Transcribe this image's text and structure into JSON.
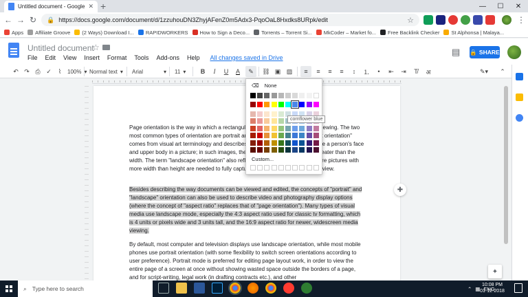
{
  "browser": {
    "tab_title": "Untitled document - Google Doc",
    "url": "https://docs.google.com/document/d/1zzuhouDN3ZhyjAFenZ0m5Adx3-PqoOaL8Hxdks8URpk/edit",
    "bookmarks": [
      {
        "label": "Apps",
        "color": "#ea4335"
      },
      {
        "label": "Affiliate Groove",
        "color": "#9e9e9e"
      },
      {
        "label": "(2 Ways) Download I...",
        "color": "#fbbc04"
      },
      {
        "label": "RAPIDWORKERS",
        "color": "#1a73e8"
      },
      {
        "label": "How to Sign a Deco...",
        "color": "#d93025"
      },
      {
        "label": "Torrents – Torrent Si...",
        "color": "#5f6368"
      },
      {
        "label": "MkCoder – Market fo...",
        "color": "#ea4335"
      },
      {
        "label": "Free Backlink Checker",
        "color": "#202124"
      },
      {
        "label": "St Alphonsa | Malaya...",
        "color": "#f9ab00"
      }
    ]
  },
  "docs": {
    "title": "Untitled document",
    "menus": [
      "File",
      "Edit",
      "View",
      "Insert",
      "Format",
      "Tools",
      "Add-ons",
      "Help"
    ],
    "save_status": "All changes saved in Drive",
    "share_label": "SHARE",
    "toolbar": {
      "zoom": "100%",
      "style": "Normal text",
      "font": "Arial",
      "size": "11"
    }
  },
  "palette": {
    "none_label": "None",
    "custom_label": "Custom...",
    "tooltip": "cornflower blue",
    "grays": [
      "#000000",
      "#434343",
      "#666666",
      "#999999",
      "#b7b7b7",
      "#cccccc",
      "#d9d9d9",
      "#efefef",
      "#f3f3f3",
      "#ffffff"
    ],
    "brights": [
      "#980000",
      "#ff0000",
      "#ff9900",
      "#ffff00",
      "#00ff00",
      "#00ffff",
      "#4a86e8",
      "#0000ff",
      "#9900ff",
      "#ff00ff"
    ],
    "shades": [
      [
        "#e6b8af",
        "#f4cccc",
        "#fce5cd",
        "#fff2cc",
        "#d9ead3",
        "#d0e0e3",
        "#c9daf8",
        "#cfe2f3",
        "#d9d2e9",
        "#ead1dc"
      ],
      [
        "#dd7e6b",
        "#ea9999",
        "#f9cb9c",
        "#ffe599",
        "#b6d7a8",
        "#a2c4c9",
        "#a4c2f4",
        "#9fc5e8",
        "#b4a7d6",
        "#d5a6bd"
      ],
      [
        "#cc4125",
        "#e06666",
        "#f6b26b",
        "#ffd966",
        "#93c47d",
        "#76a5af",
        "#6d9eeb",
        "#6fa8dc",
        "#8e7cc3",
        "#c27ba0"
      ],
      [
        "#a61c00",
        "#cc0000",
        "#e69138",
        "#f1c232",
        "#6aa84f",
        "#45818e",
        "#3c78d8",
        "#3d85c6",
        "#674ea7",
        "#a64d79"
      ],
      [
        "#85200c",
        "#990000",
        "#b45f06",
        "#bf9000",
        "#38761d",
        "#134f5c",
        "#1155cc",
        "#0b5394",
        "#351c75",
        "#741b47"
      ],
      [
        "#5b0f00",
        "#660000",
        "#783f04",
        "#7f6000",
        "#274e13",
        "#0c343d",
        "#1c4587",
        "#073763",
        "#20124d",
        "#4c1130"
      ]
    ]
  },
  "document": {
    "paragraphs": [
      "Page orientation is the way in which a rectangular page is oriented for normal viewing. The two most common types of orientation are portrait and landscape. The term \"portrait orientation\" comes from visual art terminology and describes the dimensions used to capture a person's face and upper body in a picture; in such images, the height of the display area is greater than the width. The term \"landscape orientation\" also reflects visual art terminology, where pictures with more width than height are needed to fully capture the horizon within an artist's view.",
      "Besides describing the way documents can be viewed and edited, the concepts of \"portrait\" and \"landscape\" orientation can also be used to describe video and photography display options (where the concept of \"aspect ratio\" replaces that of \"page orientation\"). Many types of visual media use landscape mode, especially the 4:3 aspect ratio used for classic tv formatting, which is 4 units or pixels wide and 3 units tall, and the 16:9 aspect ratio for newer, widescreen media viewing.",
      "By default, most computer and television displays use landscape orientation, while most mobile phones use portrait orientation (with some flexibility to switch screen orientations according to user preference). Portrait mode is preferred for editing page layout work, in order to view the entire page of a screen at once without showing wasted space outside the borders of a page, and for script-writing, legal work (in drafting contracts etc.), and other"
    ]
  },
  "taskbar": {
    "search_placeholder": "Type here to search",
    "lang": "ENG",
    "time": "10:08 PM",
    "date": "01-12-2018"
  }
}
